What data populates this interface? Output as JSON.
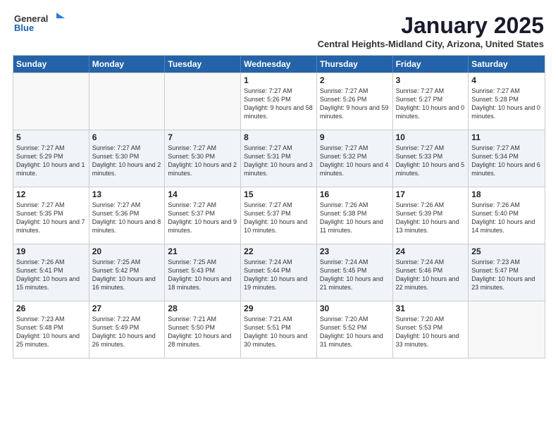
{
  "logo": {
    "general": "General",
    "blue": "Blue"
  },
  "title": "January 2025",
  "location": "Central Heights-Midland City, Arizona, United States",
  "dayNames": [
    "Sunday",
    "Monday",
    "Tuesday",
    "Wednesday",
    "Thursday",
    "Friday",
    "Saturday"
  ],
  "weeks": [
    {
      "shaded": false,
      "days": [
        {
          "date": "",
          "sunrise": "",
          "sunset": "",
          "daylight": ""
        },
        {
          "date": "",
          "sunrise": "",
          "sunset": "",
          "daylight": ""
        },
        {
          "date": "",
          "sunrise": "",
          "sunset": "",
          "daylight": ""
        },
        {
          "date": "1",
          "sunrise": "Sunrise: 7:27 AM",
          "sunset": "Sunset: 5:26 PM",
          "daylight": "Daylight: 9 hours and 58 minutes."
        },
        {
          "date": "2",
          "sunrise": "Sunrise: 7:27 AM",
          "sunset": "Sunset: 5:26 PM",
          "daylight": "Daylight: 9 hours and 59 minutes."
        },
        {
          "date": "3",
          "sunrise": "Sunrise: 7:27 AM",
          "sunset": "Sunset: 5:27 PM",
          "daylight": "Daylight: 10 hours and 0 minutes."
        },
        {
          "date": "4",
          "sunrise": "Sunrise: 7:27 AM",
          "sunset": "Sunset: 5:28 PM",
          "daylight": "Daylight: 10 hours and 0 minutes."
        }
      ]
    },
    {
      "shaded": true,
      "days": [
        {
          "date": "5",
          "sunrise": "Sunrise: 7:27 AM",
          "sunset": "Sunset: 5:29 PM",
          "daylight": "Daylight: 10 hours and 1 minute."
        },
        {
          "date": "6",
          "sunrise": "Sunrise: 7:27 AM",
          "sunset": "Sunset: 5:30 PM",
          "daylight": "Daylight: 10 hours and 2 minutes."
        },
        {
          "date": "7",
          "sunrise": "Sunrise: 7:27 AM",
          "sunset": "Sunset: 5:30 PM",
          "daylight": "Daylight: 10 hours and 2 minutes."
        },
        {
          "date": "8",
          "sunrise": "Sunrise: 7:27 AM",
          "sunset": "Sunset: 5:31 PM",
          "daylight": "Daylight: 10 hours and 3 minutes."
        },
        {
          "date": "9",
          "sunrise": "Sunrise: 7:27 AM",
          "sunset": "Sunset: 5:32 PM",
          "daylight": "Daylight: 10 hours and 4 minutes."
        },
        {
          "date": "10",
          "sunrise": "Sunrise: 7:27 AM",
          "sunset": "Sunset: 5:33 PM",
          "daylight": "Daylight: 10 hours and 5 minutes."
        },
        {
          "date": "11",
          "sunrise": "Sunrise: 7:27 AM",
          "sunset": "Sunset: 5:34 PM",
          "daylight": "Daylight: 10 hours and 6 minutes."
        }
      ]
    },
    {
      "shaded": false,
      "days": [
        {
          "date": "12",
          "sunrise": "Sunrise: 7:27 AM",
          "sunset": "Sunset: 5:35 PM",
          "daylight": "Daylight: 10 hours and 7 minutes."
        },
        {
          "date": "13",
          "sunrise": "Sunrise: 7:27 AM",
          "sunset": "Sunset: 5:36 PM",
          "daylight": "Daylight: 10 hours and 8 minutes."
        },
        {
          "date": "14",
          "sunrise": "Sunrise: 7:27 AM",
          "sunset": "Sunset: 5:37 PM",
          "daylight": "Daylight: 10 hours and 9 minutes."
        },
        {
          "date": "15",
          "sunrise": "Sunrise: 7:27 AM",
          "sunset": "Sunset: 5:37 PM",
          "daylight": "Daylight: 10 hours and 10 minutes."
        },
        {
          "date": "16",
          "sunrise": "Sunrise: 7:26 AM",
          "sunset": "Sunset: 5:38 PM",
          "daylight": "Daylight: 10 hours and 11 minutes."
        },
        {
          "date": "17",
          "sunrise": "Sunrise: 7:26 AM",
          "sunset": "Sunset: 5:39 PM",
          "daylight": "Daylight: 10 hours and 13 minutes."
        },
        {
          "date": "18",
          "sunrise": "Sunrise: 7:26 AM",
          "sunset": "Sunset: 5:40 PM",
          "daylight": "Daylight: 10 hours and 14 minutes."
        }
      ]
    },
    {
      "shaded": true,
      "days": [
        {
          "date": "19",
          "sunrise": "Sunrise: 7:26 AM",
          "sunset": "Sunset: 5:41 PM",
          "daylight": "Daylight: 10 hours and 15 minutes."
        },
        {
          "date": "20",
          "sunrise": "Sunrise: 7:25 AM",
          "sunset": "Sunset: 5:42 PM",
          "daylight": "Daylight: 10 hours and 16 minutes."
        },
        {
          "date": "21",
          "sunrise": "Sunrise: 7:25 AM",
          "sunset": "Sunset: 5:43 PM",
          "daylight": "Daylight: 10 hours and 18 minutes."
        },
        {
          "date": "22",
          "sunrise": "Sunrise: 7:24 AM",
          "sunset": "Sunset: 5:44 PM",
          "daylight": "Daylight: 10 hours and 19 minutes."
        },
        {
          "date": "23",
          "sunrise": "Sunrise: 7:24 AM",
          "sunset": "Sunset: 5:45 PM",
          "daylight": "Daylight: 10 hours and 21 minutes."
        },
        {
          "date": "24",
          "sunrise": "Sunrise: 7:24 AM",
          "sunset": "Sunset: 5:46 PM",
          "daylight": "Daylight: 10 hours and 22 minutes."
        },
        {
          "date": "25",
          "sunrise": "Sunrise: 7:23 AM",
          "sunset": "Sunset: 5:47 PM",
          "daylight": "Daylight: 10 hours and 23 minutes."
        }
      ]
    },
    {
      "shaded": false,
      "days": [
        {
          "date": "26",
          "sunrise": "Sunrise: 7:23 AM",
          "sunset": "Sunset: 5:48 PM",
          "daylight": "Daylight: 10 hours and 25 minutes."
        },
        {
          "date": "27",
          "sunrise": "Sunrise: 7:22 AM",
          "sunset": "Sunset: 5:49 PM",
          "daylight": "Daylight: 10 hours and 26 minutes."
        },
        {
          "date": "28",
          "sunrise": "Sunrise: 7:21 AM",
          "sunset": "Sunset: 5:50 PM",
          "daylight": "Daylight: 10 hours and 28 minutes."
        },
        {
          "date": "29",
          "sunrise": "Sunrise: 7:21 AM",
          "sunset": "Sunset: 5:51 PM",
          "daylight": "Daylight: 10 hours and 30 minutes."
        },
        {
          "date": "30",
          "sunrise": "Sunrise: 7:20 AM",
          "sunset": "Sunset: 5:52 PM",
          "daylight": "Daylight: 10 hours and 31 minutes."
        },
        {
          "date": "31",
          "sunrise": "Sunrise: 7:20 AM",
          "sunset": "Sunset: 5:53 PM",
          "daylight": "Daylight: 10 hours and 33 minutes."
        },
        {
          "date": "",
          "sunrise": "",
          "sunset": "",
          "daylight": ""
        }
      ]
    }
  ]
}
